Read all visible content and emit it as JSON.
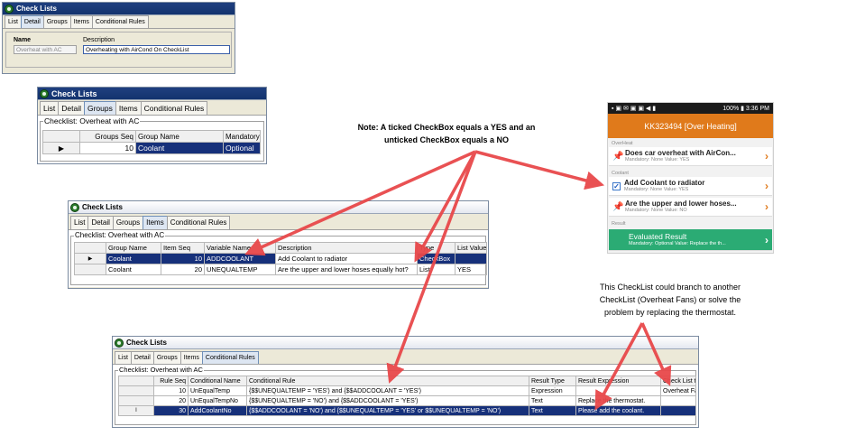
{
  "win1": {
    "title": "Check Lists",
    "tabs": [
      "List",
      "Detail",
      "Groups",
      "Items",
      "Conditional Rules"
    ],
    "name_label": "Name",
    "name_value": "Overheat with AC",
    "desc_label": "Description",
    "desc_value": "Overheating with AirCond On CheckList"
  },
  "win2": {
    "title": "Check Lists",
    "tabs": [
      "List",
      "Detail",
      "Groups",
      "Items",
      "Conditional Rules"
    ],
    "group_label": "Checklist: Overheat with AC",
    "headers": [
      "Groups Seq",
      "Group Name",
      "Mandatory Style"
    ],
    "rows": [
      [
        "10",
        "Coolant",
        "Optional"
      ]
    ]
  },
  "win3": {
    "title": "Check Lists",
    "tabs": [
      "List",
      "Detail",
      "Groups",
      "Items",
      "Conditional Rules"
    ],
    "group_label": "Checklist: Overheat with AC",
    "headers": [
      "Group Name",
      "Item Seq",
      "Variable Name",
      "Description",
      "Type",
      "List Values"
    ],
    "rows": [
      [
        "Coolant",
        "10",
        "ADDCOOLANT",
        "Add Coolant to radiator",
        "CheckBox",
        ""
      ],
      [
        "Coolant",
        "20",
        "UNEQUALTEMP",
        "Are the upper and lower hoses equally hot?",
        "List",
        "YES"
      ]
    ]
  },
  "win4": {
    "title": "Check Lists",
    "tabs": [
      "List",
      "Detail",
      "Groups",
      "Items",
      "Conditional Rules"
    ],
    "group_label": "Checklist: Overheat with AC",
    "headers": [
      "Rule Seq",
      "Conditional Name",
      "Conditional Rule",
      "Result Type",
      "Result Expression",
      "Check List to Add"
    ],
    "rows": [
      [
        "10",
        "UnEqualTemp",
        "{$$UNEQUALTEMP = 'YES') and {$$ADDCOOLANT = 'YES')",
        "Expression",
        "",
        "Overheat Fans"
      ],
      [
        "20",
        "UnEqualTempNo",
        "{$$UNEQUALTEMP = 'NO') and {$$ADDCOOLANT = 'YES')",
        "Text",
        "Replace the thermostat.",
        ""
      ],
      [
        "30",
        "AddCoolantNo",
        "{$$ADDCOOLANT = 'NO') and {$$UNEQUALTEMP = 'YES' or $$UNEQUALTEMP = 'NO')",
        "Text",
        "Please add the coolant.",
        ""
      ]
    ]
  },
  "note1": [
    "Note: A ticked CheckBox equals a YES and an",
    "unticked CheckBox equals a NO"
  ],
  "note2": [
    "This CheckList could branch to another",
    "CheckList (Overheat Fans) or solve the",
    "problem by replacing the thermostat."
  ],
  "phone": {
    "status_left": "▪ ▣ ✉ ▣ ▣ ◀ ▮",
    "status_right": "100% ▮ 3:36 PM",
    "header": "KK323494 [Over Heating]",
    "section1": "OverHeat",
    "item1_title": "Does car overheat with AirCon...",
    "item1_sub": "Mandatory: None Value: YES",
    "section2": "Coolant",
    "item2_title": "Add Coolant to radiator",
    "item2_sub": "Mandatory: None Value: YES",
    "item3_title": "Are the upper and lower hoses...",
    "item3_sub": "Mandatory: None Value: NO",
    "section3": "Result",
    "item4_title": "Evaluated Result",
    "item4_sub": "Mandatory: Optional Value: Replace the th..."
  },
  "colors": {
    "arrow": "#e8484a",
    "selected_row": "#16307a",
    "phone_header": "#e07a1b",
    "phone_result": "#2bab74"
  }
}
